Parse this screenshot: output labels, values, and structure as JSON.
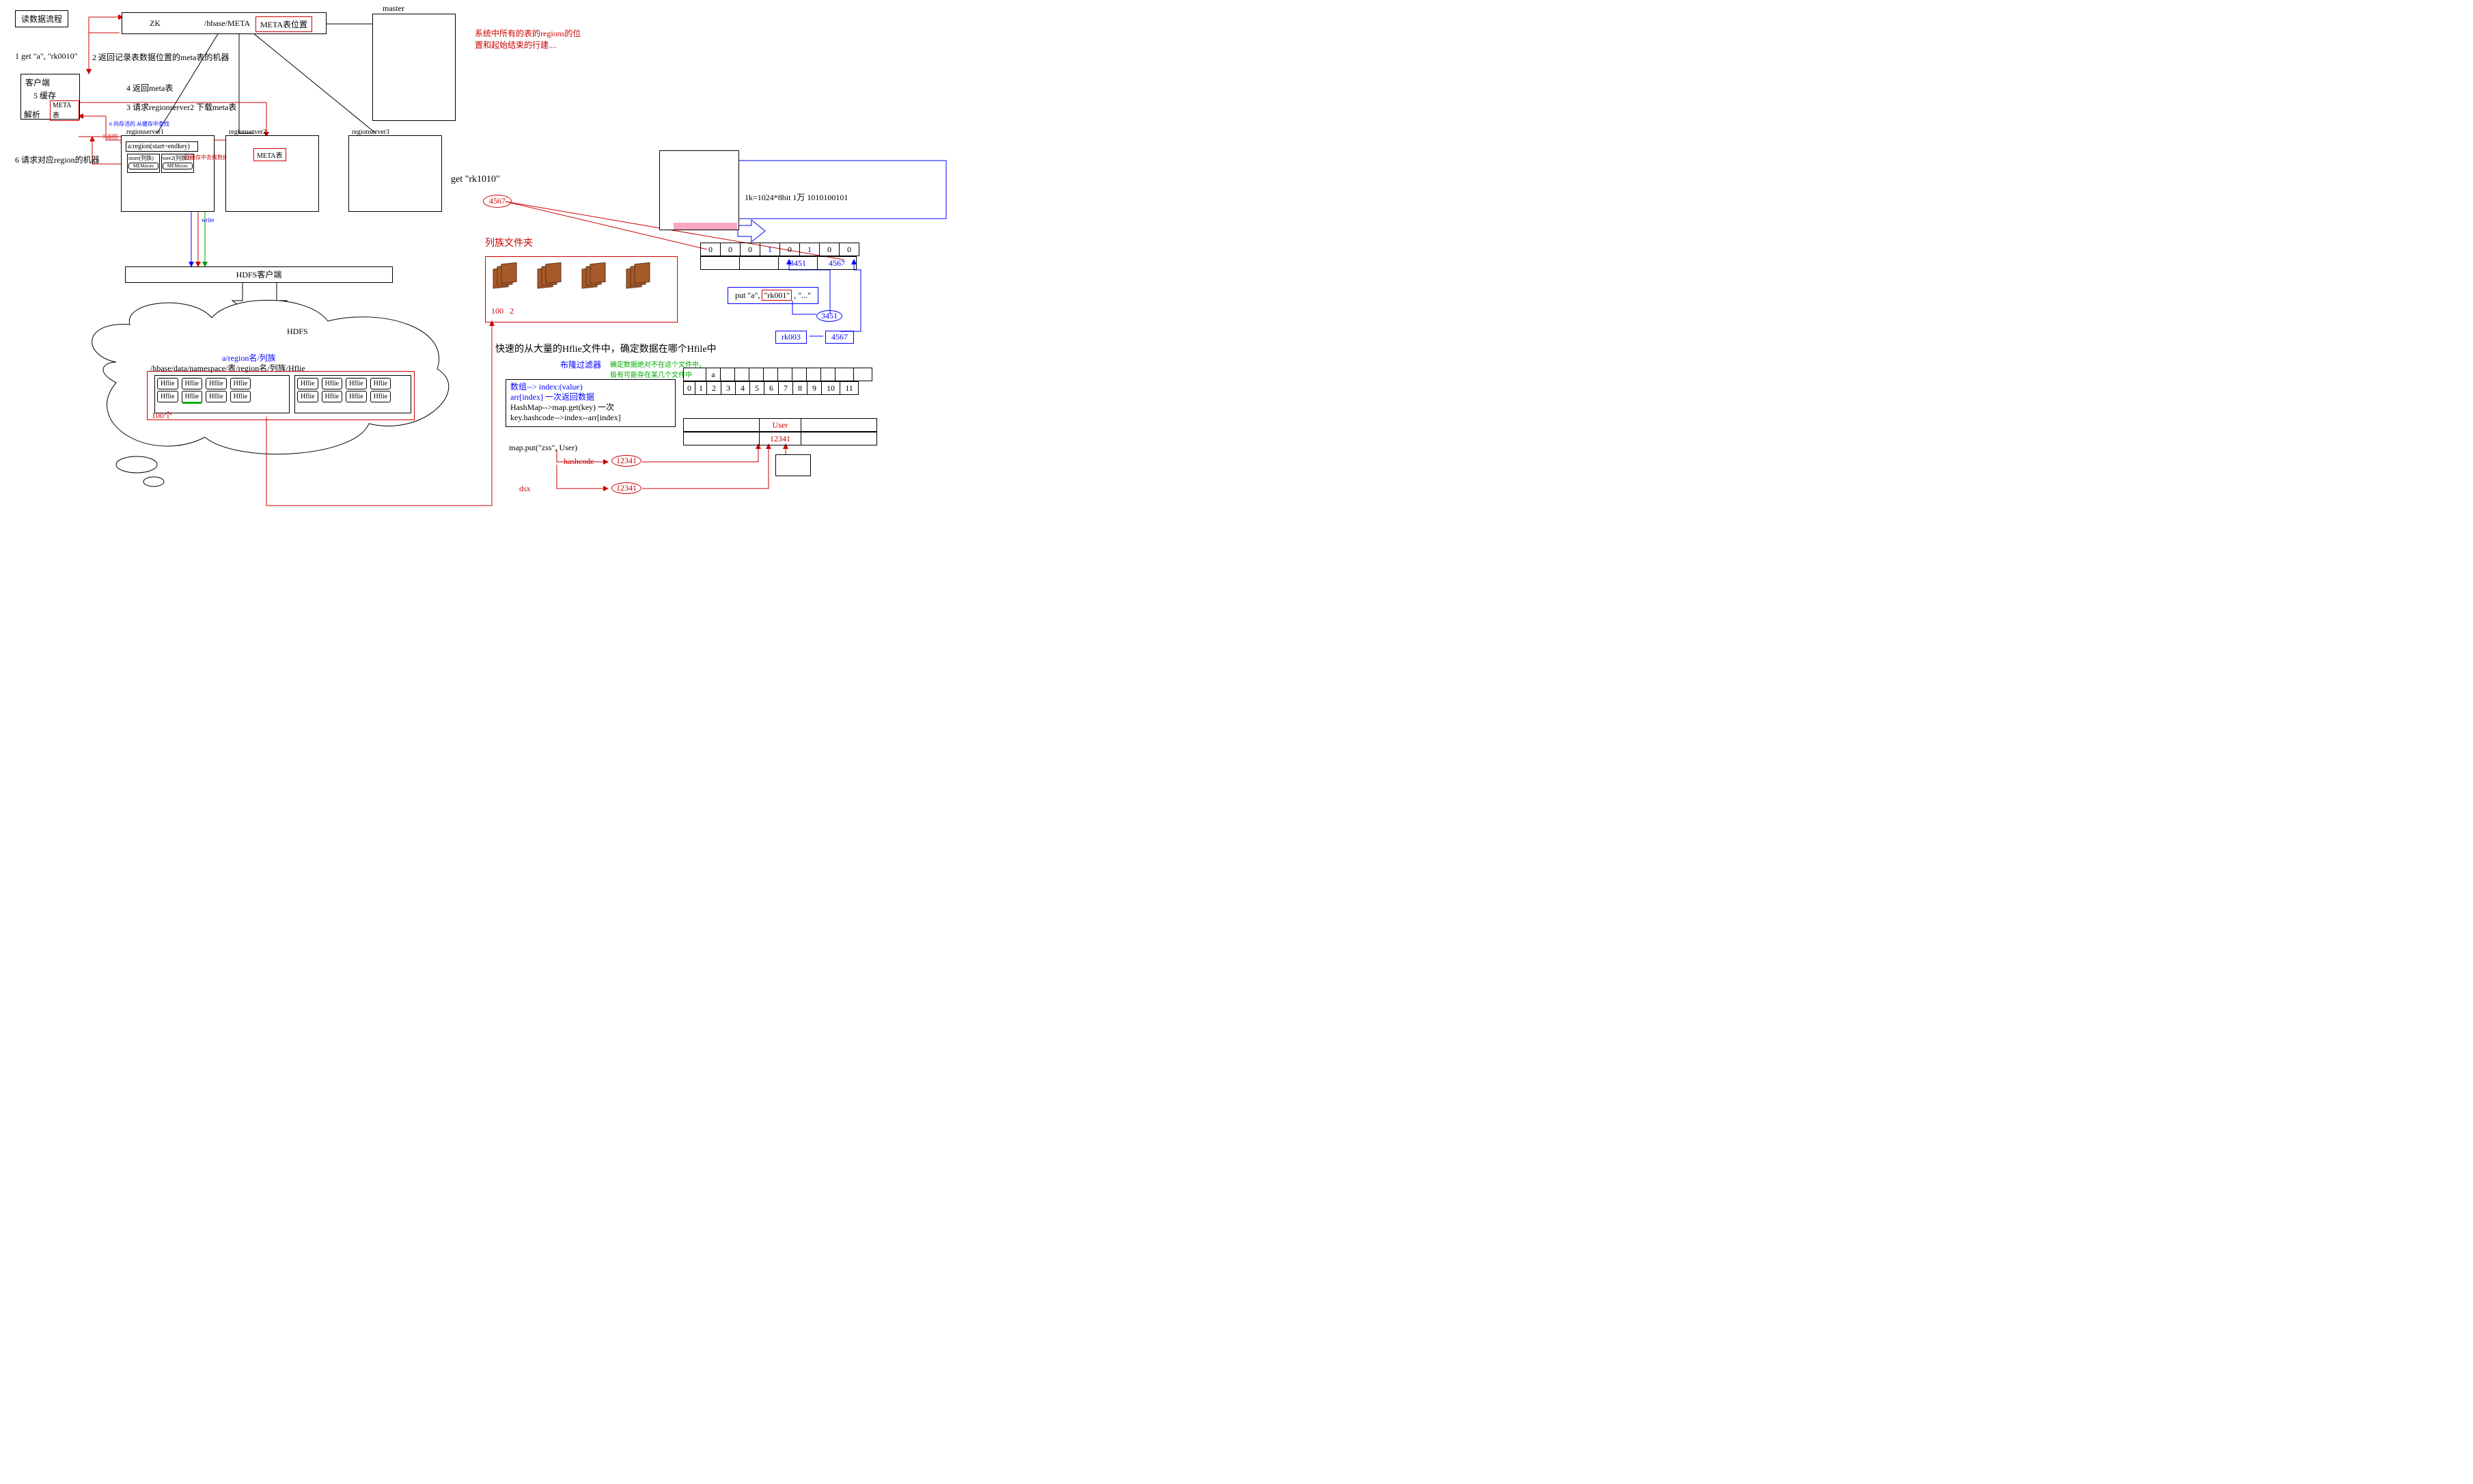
{
  "title_box": "读数据流程",
  "zk": {
    "label": "ZK",
    "path": "/hbase/META",
    "meta_btn": "META表位置"
  },
  "master": "master",
  "sys_note_l1": "系统中所有的表的regions的位",
  "sys_note_l2": "置和起始结束的行建....",
  "step1": "1 get \"a\", \"rk0010\"",
  "step2": "2 返回记录表数据位置的meta表的机器",
  "step3": "3 请求regionserver2 下载meta表",
  "step4": "4 返回meta表",
  "step5_box_title": "客户端",
  "step5_cache": "5 缓存",
  "step5_meta": "META表",
  "step5_parse": "解析",
  "step6": "6 请求对应region的机器",
  "rs1": "regionserver1",
  "rs2": "regionserver2",
  "rs3": "regionserver3",
  "rs2_meta": "META表",
  "rs1_region": "a:region(start~endkey)",
  "rs1_store1": "store(列族)",
  "rs1_store2": "tore2(列族2)",
  "rs1_mem": "MEMstore",
  "rs1_note1": "6 向存活的 从缓存中查找",
  "rs1_note2": "7 返回",
  "rs1_note3": "到缓存中去找数据",
  "rs_write": "write",
  "hdfs_client": "HDFS客户端",
  "hdfs": "HDFS",
  "hdfs_path_label": "a/region名/列族",
  "hdfs_path": "/hbase/data/namespace/表/region名/列族/Hflie",
  "hflie": "Hflie",
  "hundred": "100个",
  "get_rk": "get \"rk1010\"",
  "n4567": "4567",
  "folder_title": "列族文件夹",
  "folder_100": "100",
  "folder_2": "2",
  "fast_locate": "快速的从大量的Hflie文件中，确定数据在哪个Hfile中",
  "bloom": "布隆过滤器",
  "bloom_note1": "确定数据绝对不在这个文件中，",
  "bloom_note2": "极有可能存在某几个文件中",
  "ds_l1": "数组--> index:(value)",
  "ds_l2": "   arr[index]  一次返回数据",
  "ds_l3": "HashMap-->map.get(key) 一次",
  "ds_l4": "key.hashcode-->index--arr[index]",
  "map_put": "map.put(\"zss\", User)",
  "hashcode": "hashcode",
  "h_12341_a": "12341",
  "h_12341_b": "12341",
  "dsx": "dsx",
  "user": "User",
  "user_val": "12341",
  "bit_info": "1k=1024*8bit  1万 1010100101",
  "bits_row": [
    "0",
    "0",
    "0",
    "1",
    "0",
    "1",
    "0",
    "0"
  ],
  "bits_row2_a": "3451",
  "bits_row2_b": "4567",
  "put_line_a": "put \"a\", ",
  "put_line_b": "\"rk001\"",
  "put_line_c": ", \"...\"",
  "n3451": "3451",
  "rk003": "rk003",
  "n4567b": "4567",
  "grid_a": "a",
  "grid": [
    "0",
    "1",
    "2",
    "3",
    "4",
    "5",
    "6",
    "7",
    "8",
    "9",
    "10",
    "11"
  ]
}
